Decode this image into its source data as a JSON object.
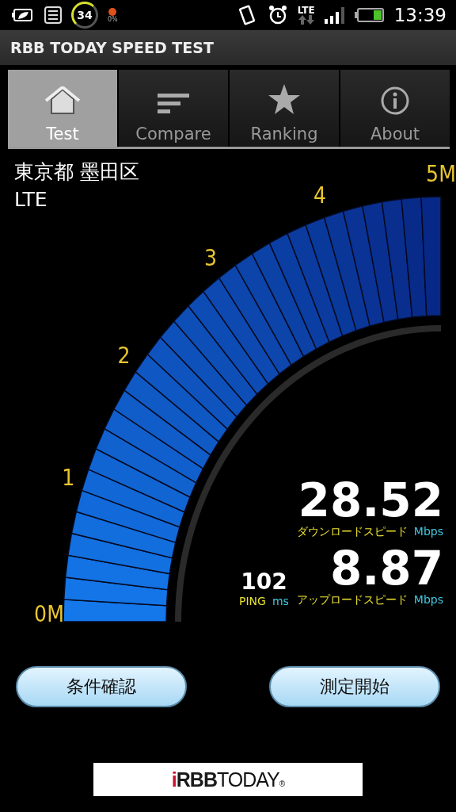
{
  "status_bar": {
    "badge": "34",
    "battery_saver": "0%",
    "network": "LTE",
    "time": "13:39"
  },
  "title_bar": {
    "title": "RBB TODAY SPEED TEST"
  },
  "tabs": [
    {
      "label": "Test",
      "selected": true
    },
    {
      "label": "Compare",
      "selected": false
    },
    {
      "label": "Ranking",
      "selected": false
    },
    {
      "label": "About",
      "selected": false
    }
  ],
  "location": {
    "area": "東京都 墨田区",
    "network": "LTE"
  },
  "gauge": {
    "ticks": [
      "0M",
      "1",
      "2",
      "3",
      "4",
      "5M"
    ]
  },
  "download": {
    "value": "28.52",
    "label": "ダウンロードスピード",
    "unit": "Mbps"
  },
  "ping": {
    "value": "102",
    "label": "PING",
    "unit": "ms"
  },
  "upload": {
    "value": "8.87",
    "label": "アップロードスピード",
    "unit": "Mbps"
  },
  "buttons": [
    "条件確認",
    "測定開始"
  ],
  "logo": {
    "accent": "i",
    "mark": "RBB",
    "name": "TODAY",
    "registered": "®"
  }
}
